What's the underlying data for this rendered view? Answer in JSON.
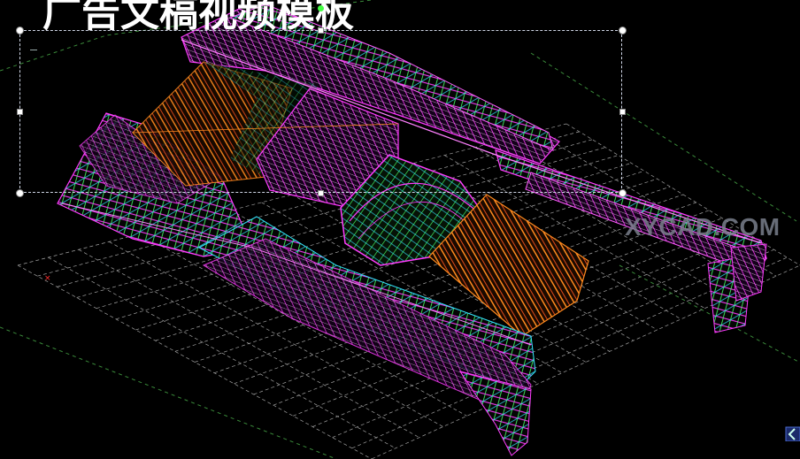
{
  "slide": {
    "title": "广告文稿视频模板",
    "watermark": "XYCAD.COM"
  },
  "colors": {
    "background": "#000000",
    "truss_magenta": "#ff3cff",
    "truss_orange": "#ff8a1e",
    "truss_green": "#44ff66",
    "truss_cyan": "#33e6ff",
    "grid": "#d8d8d8",
    "selection": "#cfd6e6",
    "rotate_handle": "#44ff44"
  },
  "icons": {
    "rotate": "rotate-handle-icon",
    "nav": "view-nav-icon"
  }
}
